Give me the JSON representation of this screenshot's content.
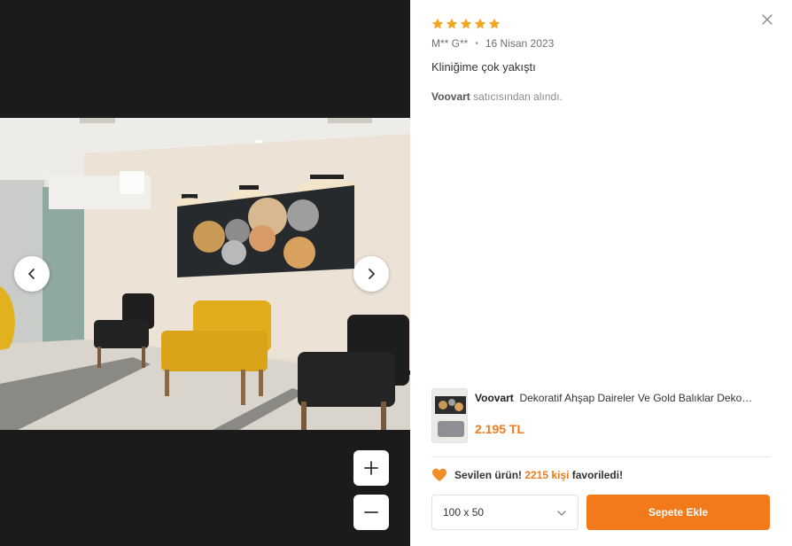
{
  "review": {
    "rating": 5,
    "author": "M** G**",
    "date": "16 Nisan 2023",
    "comment": "Kliniğime çok yakıştı",
    "seller_name": "Voovart",
    "seller_suffix": "satıcısından alındı."
  },
  "product": {
    "brand": "Voovart",
    "name": "Dekoratif Ahşap Daireler Ve Gold Balıklar Deko…",
    "price": "2.195 TL"
  },
  "favorites": {
    "prefix": "Sevilen ürün!",
    "count": "2215 kişi",
    "suffix": "favoriledi!"
  },
  "actions": {
    "size_value": "100 x 50",
    "add_to_cart": "Sepete Ekle"
  },
  "colors": {
    "accent": "#f27a1a",
    "star": "#f5a623",
    "viewer_bg": "#1b1b1b"
  },
  "icons": {
    "close": "close-icon",
    "prev": "chevron-left-icon",
    "next": "chevron-right-icon",
    "zoom_in": "plus-icon",
    "zoom_out": "minus-icon",
    "heart": "heart-icon",
    "dropdown": "chevron-down-icon",
    "star": "star-icon"
  }
}
